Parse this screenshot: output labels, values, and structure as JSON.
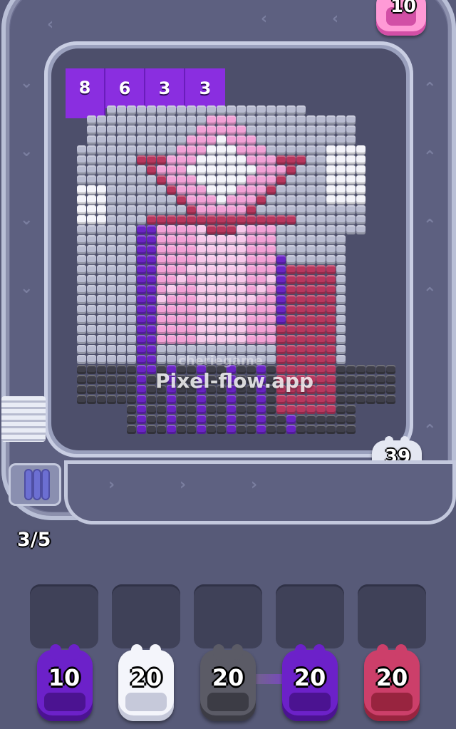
{
  "game": {
    "watermark": "Pixel-flow.app",
    "watermark_handle": "cheriegame",
    "capacity_label": "3/5"
  },
  "queue": {
    "colors": [
      "#8a2ee0",
      "#8a2ee0",
      "#8a2ee0",
      "#8a2ee0"
    ],
    "counts": [
      "8",
      "6",
      "3",
      "3"
    ]
  },
  "conveyor_units": [
    {
      "count": "10",
      "color": "#ff9ad6",
      "accent": "#d24fa6"
    },
    {
      "count": "39",
      "color": "#e4e7f2",
      "accent": "#a2a6bf"
    }
  ],
  "shooters": [
    {
      "count": "10",
      "color": "#6c21c9",
      "accent": "#4b1391"
    },
    {
      "count": "20",
      "color": "#f4f5fb",
      "accent": "#c6c9da"
    },
    {
      "count": "20",
      "color": "#5b5b66",
      "accent": "#3c3c45"
    },
    {
      "count": "20",
      "color": "#6c21c9",
      "accent": "#4b1391"
    },
    {
      "count": "20",
      "color": "#cc3f6a",
      "accent": "#98243f"
    }
  ],
  "palette": {
    "lavender": "#b8bbd0",
    "white": "#f4f4fa",
    "pink": "#f2a1d6",
    "light_pink": "#f7c8ea",
    "magenta": "#b8375e",
    "purple": "#6a24c4",
    "dark_gray": "#3f3f4a"
  }
}
